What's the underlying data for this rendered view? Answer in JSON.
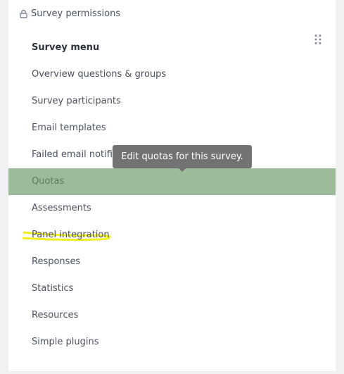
{
  "header": {
    "icon": "lock-icon",
    "label": "Survey permissions"
  },
  "menu": {
    "title": "Survey menu",
    "drag_icon": "drag-handle-icon",
    "items": [
      {
        "label": "Overview questions & groups"
      },
      {
        "label": "Survey participants"
      },
      {
        "label": "Email templates"
      },
      {
        "label": "Failed email notifications"
      },
      {
        "label": "Quotas",
        "active": true
      },
      {
        "label": "Assessments"
      },
      {
        "label": "Panel integration",
        "highlighted": true
      },
      {
        "label": "Responses"
      },
      {
        "label": "Statistics"
      },
      {
        "label": "Resources"
      },
      {
        "label": "Simple plugins"
      }
    ]
  },
  "tooltip": {
    "text": "Edit quotas for this survey."
  },
  "colors": {
    "active_background": "#9dbb9b",
    "highlight_marker": "#f2ef1f",
    "tooltip_background": "#6e6e6e"
  }
}
